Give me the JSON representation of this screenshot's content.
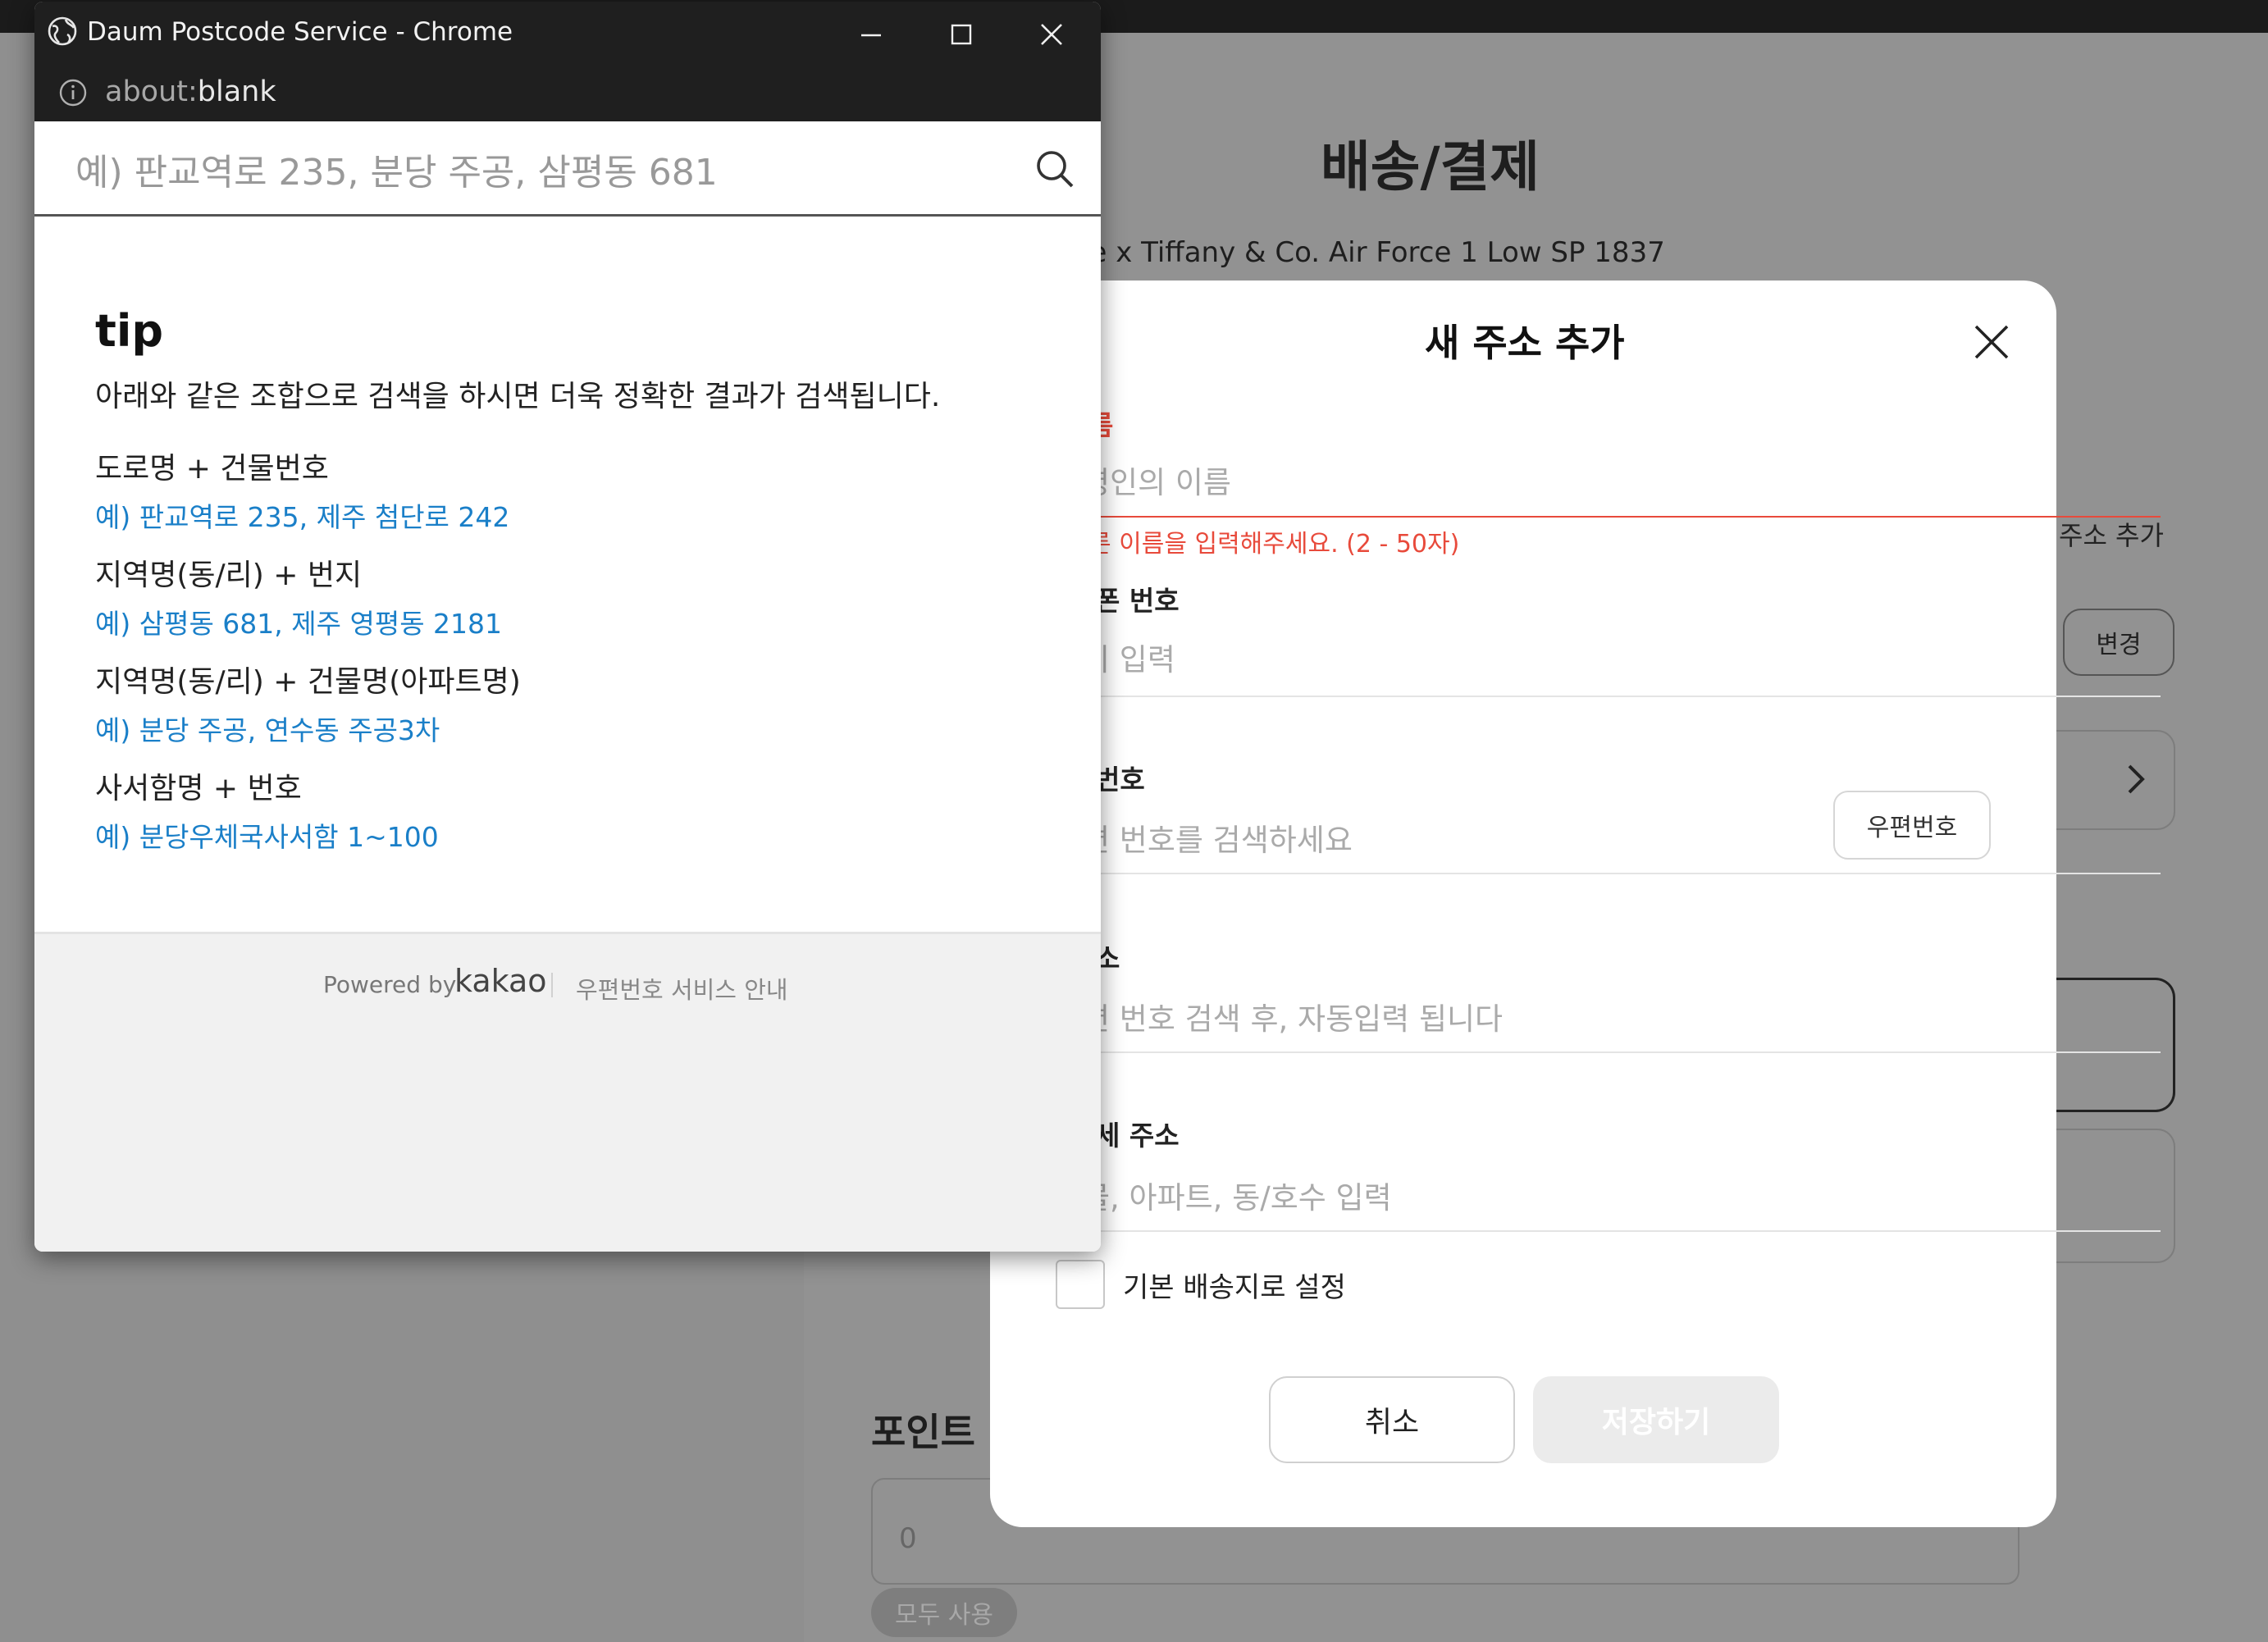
{
  "background_page": {
    "heading": "배송/결제",
    "product_name": "ke x Tiffany & Co. Air Force 1 Low SP 1837",
    "add_address": "주소 추가",
    "change_button": "변경",
    "points_title": "포인트",
    "points_value": "0",
    "use_all_button": "모두 사용"
  },
  "address_modal": {
    "title": "새 주소 추가",
    "name_label": "름",
    "name_placeholder": "령인의 이름",
    "name_error": "른 이름을 입력해주세요. (2 - 50자)",
    "phone_label": "폰 번호",
    "phone_placeholder": "이 입력",
    "zip_label": "번호",
    "zip_placeholder": "편 번호를 검색하세요",
    "zip_button": "우편번호",
    "address_label": "소",
    "address_placeholder": "편 번호 검색 후, 자동입력 됩니다",
    "detail_label": "세 주소",
    "detail_placeholder": "물, 아파트, 동/호수 입력",
    "default_checkbox_label": "기본 배송지로 설정",
    "cancel_button": "취소",
    "save_button": "저장하기"
  },
  "popup": {
    "window_title": "Daum Postcode Service - Chrome",
    "url_scheme": "about:",
    "url_path": "blank",
    "search_placeholder": "예) 판교역로 235, 분당 주공, 삼평동 681",
    "tip_title": "tip",
    "tip_description": "아래와 같은 조합으로 검색을 하시면 더욱 정확한 결과가 검색됩니다.",
    "tips": [
      {
        "heading": "도로명 + 건물번호",
        "example": "예) 판교역로 235,  제주 첨단로 242"
      },
      {
        "heading": "지역명(동/리) + 번지",
        "example": "예) 삼평동 681,  제주 영평동 2181"
      },
      {
        "heading": "지역명(동/리) + 건물명(아파트명)",
        "example": "예) 분당 주공,  연수동 주공3차"
      },
      {
        "heading": "사서함명 + 번호",
        "example": "예) 분당우체국사서함 1~100"
      }
    ],
    "footer_powered_by": "Powered by",
    "footer_brand": "kakao",
    "footer_service_guide": "우편번호 서비스 안내"
  },
  "colors": {
    "error_red": "#e84a3b",
    "link_blue": "#1a7fc8",
    "overlay_gray": "#8f8f8f",
    "titlebar_dark": "#1f1f1f"
  }
}
